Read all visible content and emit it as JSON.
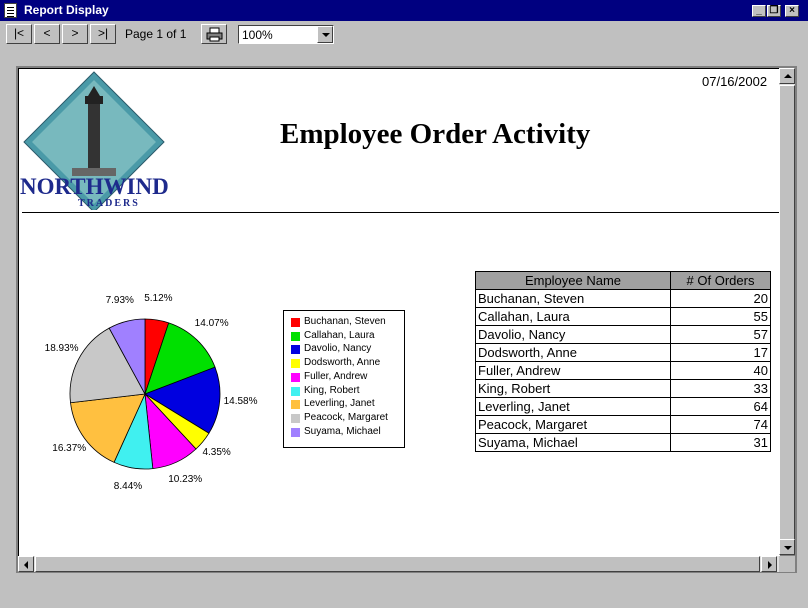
{
  "window": {
    "title": "Report Display",
    "minimize_label": "_",
    "restore_label": "❐",
    "close_label": "×"
  },
  "toolbar": {
    "first_label": "|<",
    "prev_label": "<",
    "next_label": ">",
    "last_label": ">|",
    "page_label": "Page 1 of 1",
    "print_icon": "printer-icon",
    "zoom_value": "100%"
  },
  "report": {
    "date": "07/16/2002",
    "title": "Employee Order Activity",
    "logo": {
      "brand_text": "NORTHWIND",
      "sub_text": "TRADERS"
    },
    "table": {
      "headers": [
        "Employee Name",
        "# Of Orders"
      ],
      "rows": [
        {
          "name": "Buchanan, Steven",
          "orders": "20"
        },
        {
          "name": "Callahan, Laura",
          "orders": "55"
        },
        {
          "name": "Davolio, Nancy",
          "orders": "57"
        },
        {
          "name": "Dodsworth, Anne",
          "orders": "17"
        },
        {
          "name": "Fuller, Andrew",
          "orders": "40"
        },
        {
          "name": "King, Robert",
          "orders": "33"
        },
        {
          "name": "Leverling, Janet",
          "orders": "64"
        },
        {
          "name": "Peacock, Margaret",
          "orders": "74"
        },
        {
          "name": "Suyama, Michael",
          "orders": "31"
        }
      ]
    }
  },
  "chart_data": {
    "type": "pie",
    "categories": [
      "Buchanan, Steven",
      "Callahan, Laura",
      "Davolio, Nancy",
      "Dodsworth, Anne",
      "Fuller, Andrew",
      "King, Robert",
      "Leverling, Janet",
      "Peacock, Margaret",
      "Suyama, Michael"
    ],
    "values": [
      20,
      55,
      57,
      17,
      40,
      33,
      64,
      74,
      31
    ],
    "labels": [
      "5.12%",
      "14.07%",
      "14.58%",
      "4.35%",
      "10.23%",
      "8.44%",
      "16.37%",
      "18.93%",
      "7.93%"
    ],
    "colors": [
      "#ff0000",
      "#00e000",
      "#0000e0",
      "#ffff00",
      "#ff00ff",
      "#40f0f0",
      "#ffc040",
      "#c8c8c8",
      "#a080ff"
    ],
    "legend_position": "right"
  }
}
